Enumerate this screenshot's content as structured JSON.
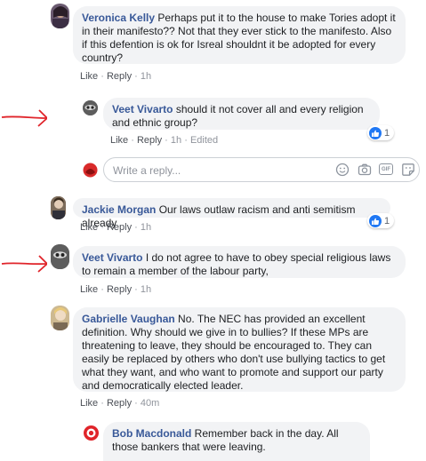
{
  "comments": [
    {
      "author": "Veronica Kelly",
      "text": " Perhaps put it to the house to make Tories adopt it in their manifesto?? Not that they ever stick to the manifesto. Also if this defention is ok for Isreal shouldnt it be adopted for every country?",
      "like": "Like",
      "reply": "Reply",
      "time": "1h"
    },
    {
      "author": "Veet Vivarto",
      "text": " should it not cover all and every religion and ethnic group?",
      "like": "Like",
      "reply": "Reply",
      "time": "1h",
      "edited": "Edited",
      "reaction_count": "1"
    },
    {
      "author": "Jackie Morgan",
      "text": " Our laws outlaw racism and anti semitism already",
      "like": "Like",
      "reply": "Reply",
      "time": "1h",
      "reaction_count": "1"
    },
    {
      "author": "Veet Vivarto",
      "text": " I do not agree to have to obey special religious laws to remain a member of the labour party,",
      "like": "Like",
      "reply": "Reply",
      "time": "1h"
    },
    {
      "author": "Gabrielle Vaughan",
      "text": " No. The NEC has provided an excellent definition. Why should we give in to bullies? If these MPs are threatening to leave, they should be encouraged to. They can easily be replaced by others who don't use bullying tactics to get what they want, and who want to promote and support our party and democratically elected leader.",
      "like": "Like",
      "reply": "Reply",
      "time": "40m"
    },
    {
      "author": "Bob Macdonald",
      "text": " Remember back in the day. All those bankers that were leaving."
    }
  ],
  "reply_box": {
    "placeholder": "Write a reply...",
    "gif_label": "GIF"
  },
  "separator": "·",
  "colors": {
    "author": "#385898",
    "bubble": "#f2f3f5",
    "like_blue": "#2078f4",
    "annotation_arrow": "#e0242a"
  },
  "icons": [
    "emoji-icon",
    "camera-icon",
    "gif-icon",
    "sticker-icon",
    "like-reaction-icon"
  ]
}
